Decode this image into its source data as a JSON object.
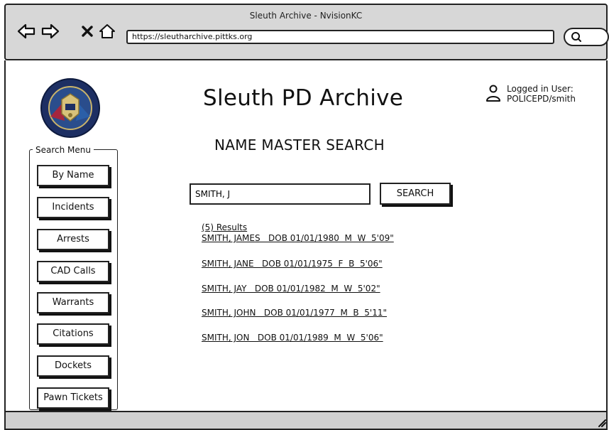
{
  "window": {
    "title": "Sleuth Archive - NvisionKC"
  },
  "browser": {
    "url": "https://sleutharchive.pittks.org"
  },
  "app": {
    "title": "Sleuth PD Archive"
  },
  "user": {
    "label": "Logged in User:",
    "name": "POLICEPD/smith"
  },
  "page": {
    "section_title": "NAME MASTER SEARCH"
  },
  "search_menu": {
    "legend": "Search Menu",
    "items": [
      {
        "label": "By Name"
      },
      {
        "label": "Incidents"
      },
      {
        "label": "Arrests"
      },
      {
        "label": "CAD Calls"
      },
      {
        "label": "Warrants"
      },
      {
        "label": "Citations"
      },
      {
        "label": "Dockets"
      },
      {
        "label": "Pawn Tickets"
      }
    ]
  },
  "search": {
    "value": "SMITH, J",
    "button_label": "SEARCH"
  },
  "results": {
    "count_label": "(5) Results",
    "items": [
      {
        "text": "SMITH, JAMES   DOB 01/01/1980  M  W  5'09\""
      },
      {
        "text": "SMITH, JANE   DOB 01/01/1975  F  B  5'06\""
      },
      {
        "text": "SMITH, JAY   DOB 01/01/1982  M  W  5'02\""
      },
      {
        "text": "SMITH, JOHN   DOB 01/01/1977  M  B  5'11\""
      },
      {
        "text": "SMITH, JON   DOB 01/01/1989  M  W  5'06\""
      }
    ]
  }
}
